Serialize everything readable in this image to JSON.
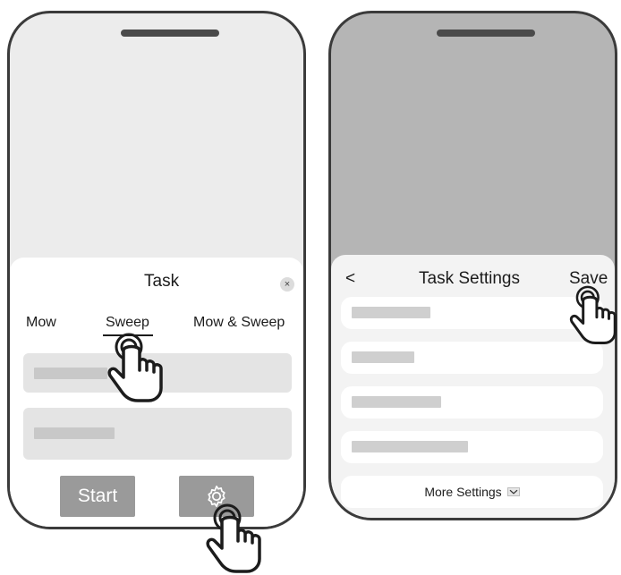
{
  "left_screen": {
    "sheet_title": "Task",
    "close_icon": "×",
    "tabs": [
      {
        "label": "Mow",
        "selected": false
      },
      {
        "label": "Sweep",
        "selected": true
      },
      {
        "label": "Mow & Sweep",
        "selected": false
      }
    ],
    "start_label": "Start",
    "settings_icon": "gear-icon"
  },
  "right_screen": {
    "back_icon": "<",
    "sheet_title": "Task Settings",
    "save_label": "Save",
    "more_settings_label": "More Settings",
    "more_settings_icon": "chevron-down-icon"
  },
  "colors": {
    "screen_bg": "#ececec",
    "overlay_bg": "#b5b5b5",
    "button_gray": "#9a9a9a",
    "placeholder": "#c8c8c8",
    "frame": "#3b3b3b"
  }
}
